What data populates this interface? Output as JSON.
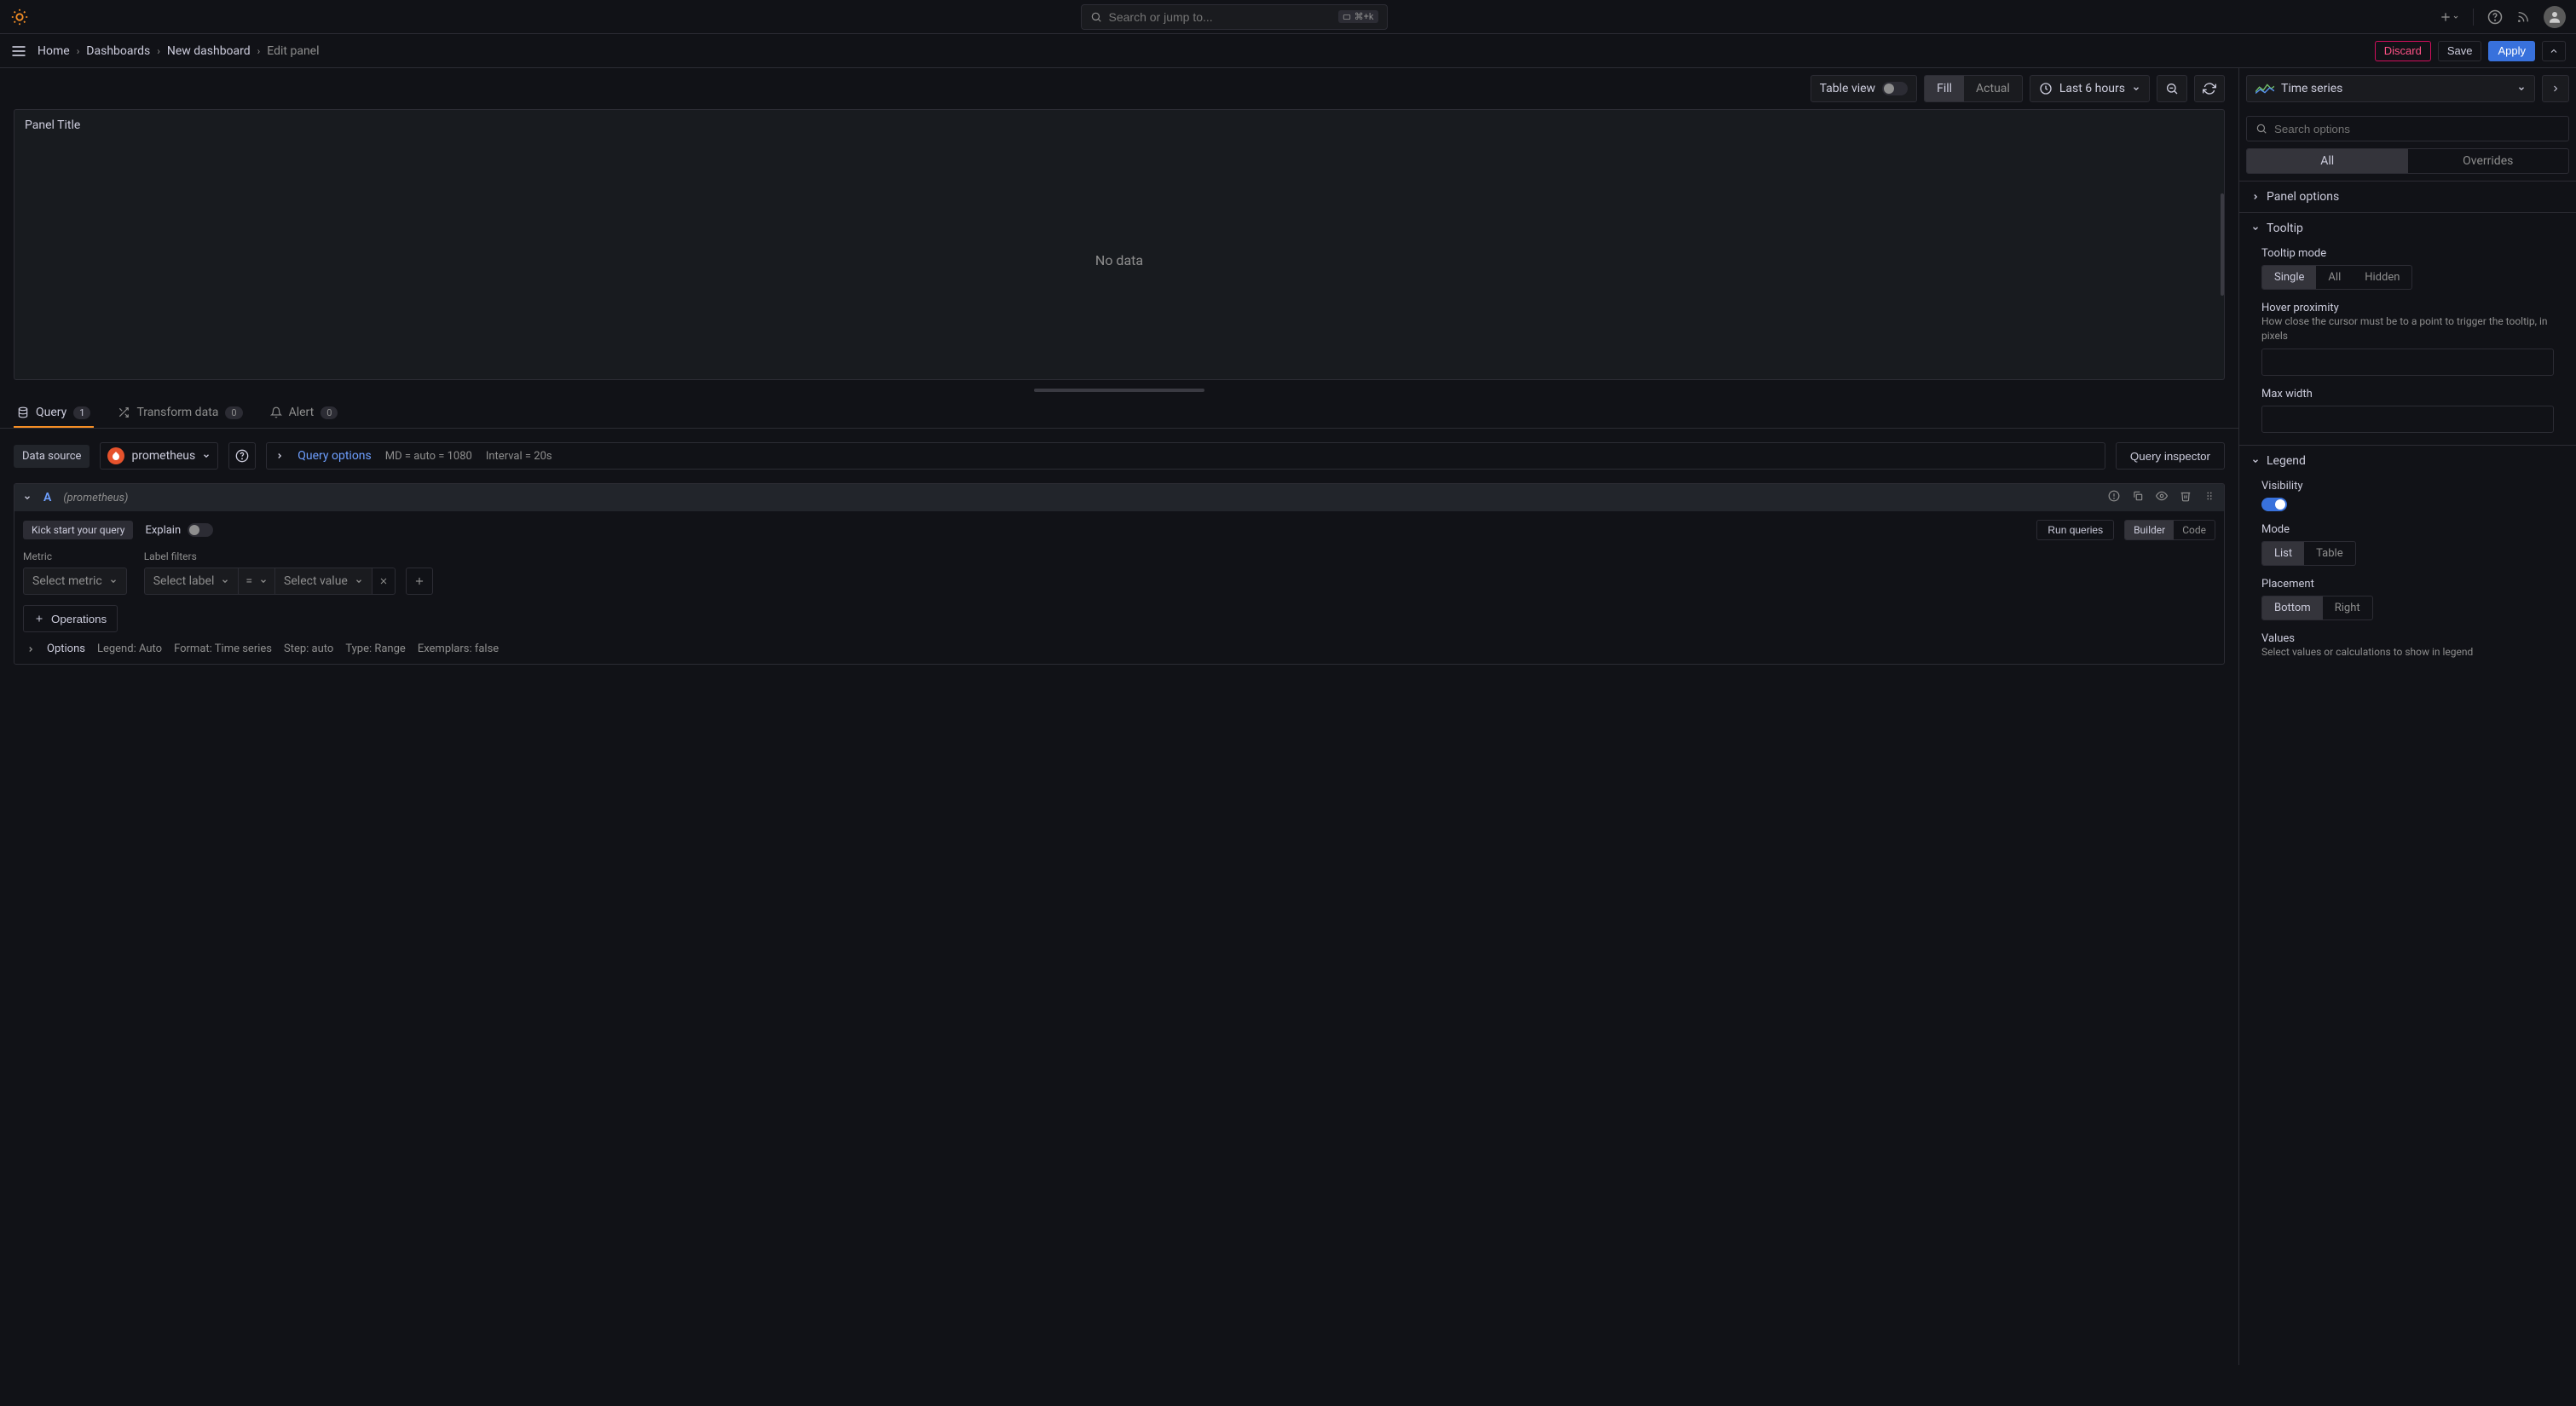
{
  "topbar": {
    "search_placeholder": "Search or jump to...",
    "kbd_shortcut": "⌘+k"
  },
  "breadcrumb": {
    "items": [
      "Home",
      "Dashboards",
      "New dashboard"
    ],
    "current": "Edit panel",
    "discard": "Discard",
    "save": "Save",
    "apply": "Apply"
  },
  "toolbar": {
    "table_view_label": "Table view",
    "fill": "Fill",
    "actual": "Actual",
    "time_range": "Last 6 hours",
    "viz_type": "Time series"
  },
  "panel": {
    "title": "Panel Title",
    "no_data": "No data"
  },
  "tabs": {
    "query": "Query",
    "query_count": "1",
    "transform": "Transform data",
    "transform_count": "0",
    "alert": "Alert",
    "alert_count": "0"
  },
  "ds": {
    "label": "Data source",
    "name": "prometheus",
    "query_options": "Query options",
    "md_label": "MD",
    "md_val": "auto = 1080",
    "interval_label": "Interval",
    "interval_val": "20s",
    "inspector": "Query inspector"
  },
  "query": {
    "letter": "A",
    "ds_sub": "(prometheus)",
    "kick": "Kick start your query",
    "explain": "Explain",
    "run": "Run queries",
    "builder": "Builder",
    "code": "Code",
    "metric_label": "Metric",
    "metric_ph": "Select metric",
    "filters_label": "Label filters",
    "label_ph": "Select label",
    "op": "=",
    "value_ph": "Select value",
    "operations": "Operations",
    "options": "Options",
    "footer": {
      "legend": "Legend: Auto",
      "format": "Format: Time series",
      "step": "Step: auto",
      "type": "Type: Range",
      "exemplars": "Exemplars: false"
    }
  },
  "right": {
    "search_ph": "Search options",
    "tab_all": "All",
    "tab_over": "Overrides",
    "panel_options": "Panel options",
    "tooltip": {
      "title": "Tooltip",
      "mode_label": "Tooltip mode",
      "single": "Single",
      "all": "All",
      "hidden": "Hidden",
      "hover_label": "Hover proximity",
      "hover_desc": "How close the cursor must be to a point to trigger the tooltip, in pixels",
      "max_width": "Max width"
    },
    "legend": {
      "title": "Legend",
      "visibility": "Visibility",
      "mode": "Mode",
      "list": "List",
      "table": "Table",
      "placement": "Placement",
      "bottom": "Bottom",
      "right": "Right",
      "values": "Values",
      "values_desc": "Select values or calculations to show in legend"
    }
  }
}
